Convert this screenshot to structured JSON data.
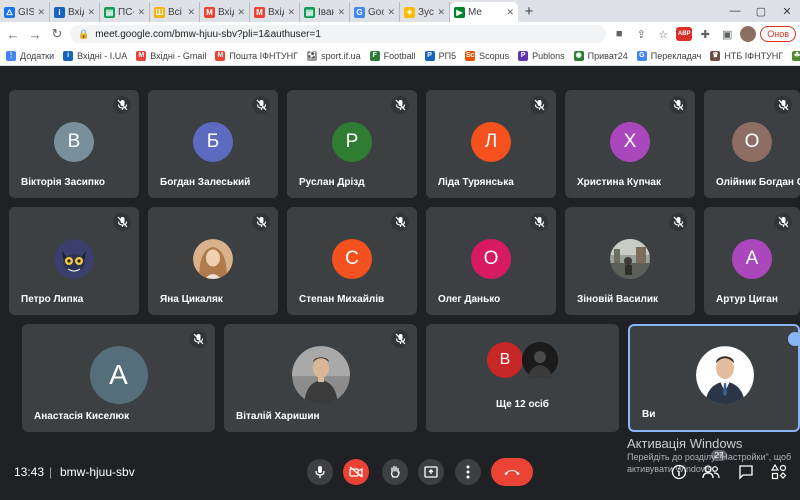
{
  "browser": {
    "tabs": [
      {
        "label": "GISME",
        "fav": "🜂",
        "color": "#1a73e8"
      },
      {
        "label": "Вхідні",
        "fav": "i",
        "color": "#1565c0"
      },
      {
        "label": "ПС-Ро",
        "fav": "▤",
        "color": "#0f9d58"
      },
      {
        "label": "Всі нов",
        "fav": "Ш",
        "color": "#f4b400"
      },
      {
        "label": "Вхідні",
        "fav": "M",
        "color": "#ea4335"
      },
      {
        "label": "Вхідні",
        "fav": "M",
        "color": "#ea4335"
      },
      {
        "label": "Івано-",
        "fav": "▤",
        "color": "#0f9d58"
      },
      {
        "label": "Google",
        "fav": "G",
        "color": "#4285f4"
      },
      {
        "label": "Зустрі",
        "fav": "✦",
        "color": "#fbbc04"
      },
      {
        "label": "Me",
        "fav": "▶",
        "color": "#00832d"
      }
    ],
    "new_tab": "+",
    "url": "meet.google.com/bmw-hjuu-sbv?pli=1&authuser=1",
    "update_label": "Онов",
    "abp_label": "ABP"
  },
  "bookmarks": [
    {
      "label": "Додатки",
      "fav": "⋮",
      "color": "#4285f4"
    },
    {
      "label": "Вхідні - I.UA",
      "fav": "i",
      "color": "#1565c0"
    },
    {
      "label": "Вхідні - Gmail",
      "fav": "M",
      "color": "#ea4335"
    },
    {
      "label": "Пошта ІФНТУНГ",
      "fav": "M",
      "color": "#ea4335"
    },
    {
      "label": "sport.if.ua",
      "fav": "⚽",
      "color": "#9e9e9e"
    },
    {
      "label": "Football",
      "fav": "F",
      "color": "#2e7d32"
    },
    {
      "label": "РП5",
      "fav": "P",
      "color": "#1565c0"
    },
    {
      "label": "Scopus",
      "fav": "Sc",
      "color": "#e65100"
    },
    {
      "label": "Publons",
      "fav": "P",
      "color": "#5e35b1"
    },
    {
      "label": "Приват24",
      "fav": "◉",
      "color": "#2e7d32"
    },
    {
      "label": "Перекладач",
      "fav": "G",
      "color": "#4285f4"
    },
    {
      "label": "НТБ ІФНТУНГ",
      "fav": "♛",
      "color": "#6d4c41"
    },
    {
      "label": "db.uaf.ua",
      "fav": "☘",
      "color": "#558b2f"
    }
  ],
  "participants": [
    {
      "name": "Вікторія Засипко",
      "initial": "В",
      "color": "#78909c"
    },
    {
      "name": "Богдан Залеський",
      "initial": "Б",
      "color": "#5c6bc0"
    },
    {
      "name": "Руслан Дрізд",
      "initial": "Р",
      "color": "#2e7d32"
    },
    {
      "name": "Ліда Турянська",
      "initial": "Л",
      "color": "#f4511e"
    },
    {
      "name": "Христина Купчак",
      "initial": "Х",
      "color": "#ab47bc"
    },
    {
      "name": "Олійник Богдан С",
      "initial": "О",
      "color": "#8d6e63"
    },
    {
      "name": "Петро Липка",
      "initial": "",
      "color": "#4a4e69"
    },
    {
      "name": "Яна Цикаляк",
      "initial": "",
      "color": "#c49a6c"
    },
    {
      "name": "Степан Михайлів",
      "initial": "С",
      "color": "#f4511e"
    },
    {
      "name": "Олег Данько",
      "initial": "О",
      "color": "#d81b60"
    },
    {
      "name": "Зіновій Василик",
      "initial": "",
      "color": "#6d6f73"
    },
    {
      "name": "Артур Циган",
      "initial": "А",
      "color": "#ab47bc"
    },
    {
      "name": "Анастасія Киселюк",
      "initial": "A",
      "color": "#546e7a"
    },
    {
      "name": "Віталій Харишин",
      "initial": "",
      "color": "#707070"
    }
  ],
  "others": {
    "label": "Ще 12 осіб",
    "initial": "В",
    "color": "#c62828"
  },
  "self": {
    "name": "Ви"
  },
  "meeting": {
    "time": "13:43",
    "code": "bmw-hjuu-sbv",
    "participants_badge": "27"
  },
  "watermark": {
    "title": "Активація Windows",
    "line1": "Перейдіть до розділу \"Настройки\", щоб",
    "line2": "активувати Windows."
  }
}
